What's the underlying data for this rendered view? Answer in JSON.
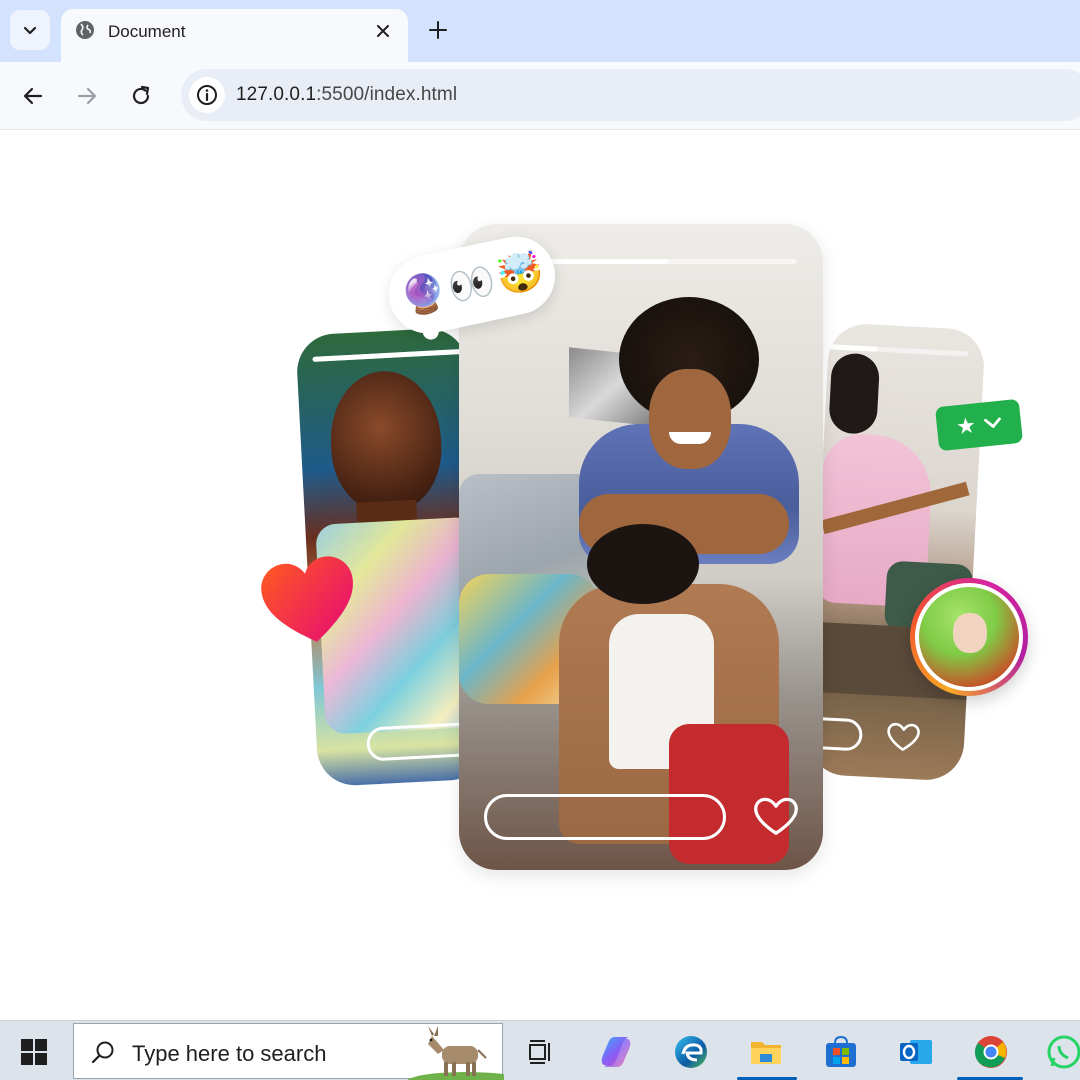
{
  "browser": {
    "tab": {
      "title": "Document"
    },
    "url": {
      "host": "127.0.0.1",
      "path": ":5500/index.html"
    }
  },
  "page": {
    "emoji_bubble": [
      "🔮",
      "👀",
      "🤯"
    ],
    "rating_badge": {
      "star": "★",
      "chevron": "⌄"
    },
    "stories": [
      {
        "name": "left-story",
        "progress": 1.0
      },
      {
        "name": "center-story",
        "progress": 0.62
      },
      {
        "name": "right-story",
        "progress": 0.35
      }
    ],
    "colors": {
      "heart_start": "#ff5a1f",
      "heart_end": "#e4067a",
      "rating_green": "#21b04b"
    }
  },
  "taskbar": {
    "search_placeholder": "Type here to search",
    "apps": [
      "task-view",
      "copilot",
      "edge",
      "file-explorer",
      "microsoft-store",
      "outlook",
      "chrome",
      "whatsapp"
    ]
  }
}
